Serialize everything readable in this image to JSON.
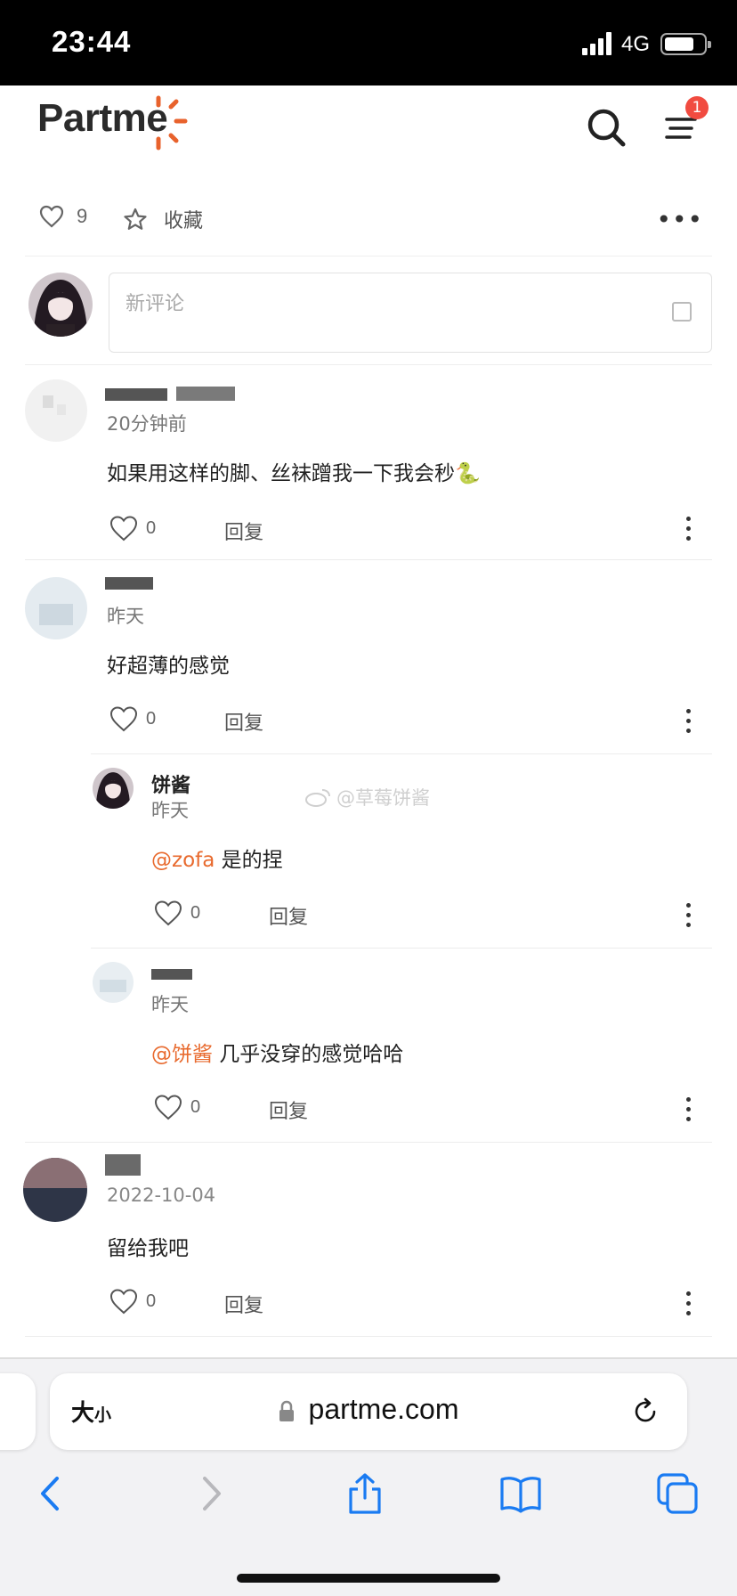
{
  "status_bar": {
    "time": "23:44",
    "network": "4G"
  },
  "header": {
    "logo_text": "Partme",
    "menu_badge": "1",
    "colors": {
      "brand_orange": "#e8622c",
      "badge": "#f14b40"
    }
  },
  "post_actions": {
    "like_count": "9",
    "favorite_label": "收藏"
  },
  "new_comment": {
    "placeholder": "新评论"
  },
  "comments": [
    {
      "time": "20分钟前",
      "text": "如果用这样的脚、丝袜蹭我一下我会秒🐍",
      "likes": "0",
      "reply_label": "回复"
    },
    {
      "time": "昨天",
      "text": "好超薄的感觉",
      "likes": "0",
      "reply_label": "回复",
      "replies": [
        {
          "author": "饼酱",
          "time": "昨天",
          "mention": "@zofa",
          "text": " 是的捏",
          "likes": "0",
          "reply_label": "回复"
        },
        {
          "time": "昨天",
          "mention": "@饼酱",
          "text": " 几乎没穿的感觉哈哈",
          "likes": "0",
          "reply_label": "回复"
        }
      ]
    },
    {
      "time": "2022-10-04",
      "text": "留给我吧",
      "likes": "0",
      "reply_label": "回复"
    }
  ],
  "watermark": "@草莓饼酱",
  "browser": {
    "text_size_label": "大",
    "text_size_small": "小",
    "url": "partme.com"
  }
}
